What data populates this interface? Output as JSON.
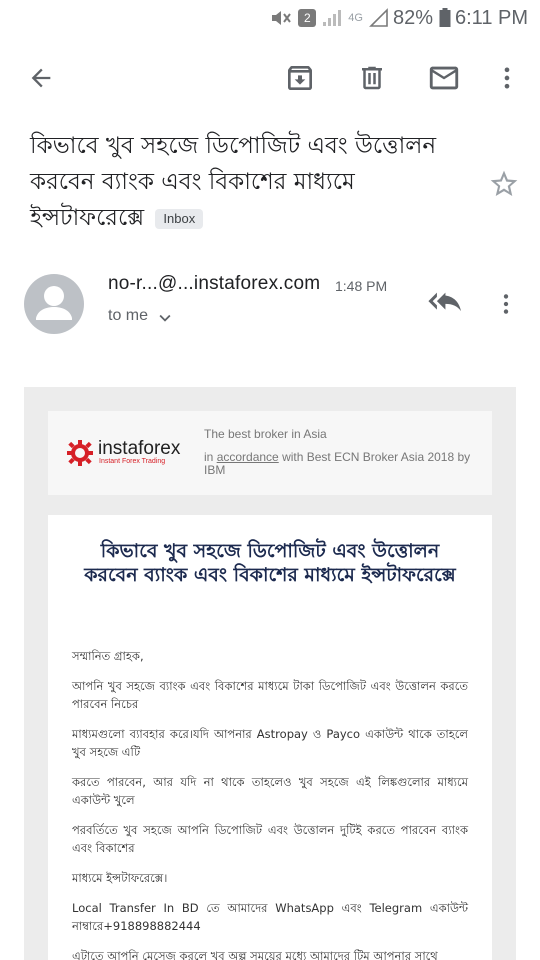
{
  "status_bar": {
    "badge": "2",
    "network": "4G",
    "battery": "82%",
    "time": "6:11 PM"
  },
  "toolbar": {
    "icons": [
      "back-arrow-icon",
      "archive-icon",
      "delete-icon",
      "mark-unread-icon",
      "more-vert-icon"
    ]
  },
  "message": {
    "subject": "কিভাবে খুব সহজে ডিপোজিট এবং উত্তোলন করবেন ব্যাংক এবং বিকাশের মাধ্যমে ইন্সটাফরেক্সে",
    "label": "Inbox",
    "sender": "no-r...@...instaforex.com",
    "time": "1:48 PM",
    "recipient": "to me"
  },
  "email": {
    "brand": "instaforex",
    "brand_tagline": "Instant Forex Trading",
    "header_line1": "The best broker in Asia",
    "header_line2_prefix": "in",
    "header_link": "accordance",
    "header_line2_suffix": "with Best ECN Broker Asia 2018 by IBM",
    "title": "কিভাবে খুব সহজে ডিপোজিট এবং উত্তোলন করবেন ব্যাংক এবং বিকাশের মাধ্যমে ইন্সটাফরেক্সে",
    "paragraphs": [
      "সম্মানিত গ্রাহক,",
      "আপনি খুব সহজে  ব্যাংক এবং বিকাশের মাধ্যমে টাকা ডিপোজিট  এবং উত্তোলন করতে পারবেন নিচের",
      "মাধ্যমগুলো ব্যাবহার করে।যদি আপনার  Astropay ও  Payco একাউন্ট থাকে তাহলে খুব সহজে এটি",
      "করতে পারবেন, আর যদি না থাকে তাহলেও খুব সহজে এই লিঙ্কগুলোর মাধ্যমে একাউন্ট খুলে",
      "পরবর্তিতে খুব সহজে আপনি ডিপোজিট এবং উত্তোলন দুটিই করতে পারবেন ব্যাংক এবং বিকাশের",
      "মাধ্যমে ইন্সটাফরেক্সে।",
      "Local Transfer In BD তে আমাদের WhatsApp এবং Telegram একাউন্ট নাম্বারে+918898882444",
      "এটাতে আপনি মেসেজ করলে খুব অল্প সময়ের মধ্যে আমাদের টিম আপনার সাথে"
    ]
  },
  "colors": {
    "brand_red": "#d62027",
    "title_navy": "#1c2a4f",
    "icon_gray": "#5f6368"
  }
}
